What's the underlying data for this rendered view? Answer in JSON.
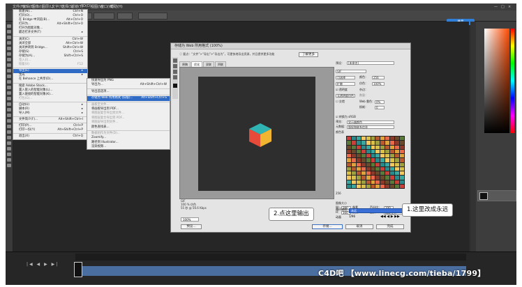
{
  "app": {
    "menubar": [
      "文件(F)",
      "编辑(E)",
      "图像(I)",
      "图层(L)",
      "文字(Y)",
      "选择(S)",
      "滤镜(T)",
      "3D(D)",
      "视图(V)",
      "窗口(W)",
      "帮助(H)"
    ],
    "share_label": "共享",
    "window_controls": [
      "—",
      "□",
      "×"
    ]
  },
  "file_menu": {
    "items": [
      {
        "label": "新建(N)...",
        "shortcut": "Ctrl+N",
        "dim": false
      },
      {
        "label": "打开(O)...",
        "shortcut": "Ctrl+O",
        "dim": false
      },
      {
        "label": "在 Bridge 中浏览(B)...",
        "shortcut": "Alt+Ctrl+O",
        "dim": false
      },
      {
        "label": "打开为...",
        "shortcut": "Alt+Shift+Ctrl+O",
        "dim": false
      },
      {
        "label": "打开为智能对象...",
        "shortcut": "",
        "dim": false
      },
      {
        "label": "最近打开文件(T)",
        "shortcut": "▸",
        "dim": false
      },
      {
        "sep": true
      },
      {
        "label": "关闭(C)",
        "shortcut": "Ctrl+W",
        "dim": false
      },
      {
        "label": "关闭全部",
        "shortcut": "Alt+Ctrl+W",
        "dim": false
      },
      {
        "label": "关闭并转到 Bridge...",
        "shortcut": "Shift+Ctrl+W",
        "dim": false
      },
      {
        "label": "存储(S)",
        "shortcut": "Ctrl+S",
        "dim": false
      },
      {
        "label": "存储为(A)...",
        "shortcut": "Shift+Ctrl+S",
        "dim": false
      },
      {
        "label": "签入(I)...",
        "shortcut": "",
        "dim": true
      },
      {
        "label": "恢复(V)",
        "shortcut": "F12",
        "dim": true
      },
      {
        "sep": true
      },
      {
        "label": "导出(E)",
        "shortcut": "▸",
        "dim": false,
        "active": true
      },
      {
        "label": "生成",
        "shortcut": "▸",
        "dim": false
      },
      {
        "label": "在 Behance 上共享(D)...",
        "shortcut": "",
        "dim": false
      },
      {
        "sep": true
      },
      {
        "label": "搜索 Adobe Stock...",
        "shortcut": "",
        "dim": false
      },
      {
        "label": "置入嵌入的智能对象(L)...",
        "shortcut": "",
        "dim": false
      },
      {
        "label": "置入链接的智能对象(K)...",
        "shortcut": "",
        "dim": false
      },
      {
        "label": "打包(G)...",
        "shortcut": "",
        "dim": true
      },
      {
        "sep": true
      },
      {
        "label": "自动(U)",
        "shortcut": "▸",
        "dim": false
      },
      {
        "label": "脚本(R)",
        "shortcut": "▸",
        "dim": false
      },
      {
        "label": "导入(M)",
        "shortcut": "▸",
        "dim": false
      },
      {
        "sep": true
      },
      {
        "label": "文件简介(F)...",
        "shortcut": "Alt+Shift+Ctrl+I",
        "dim": false
      },
      {
        "sep": true
      },
      {
        "label": "打印(P)...",
        "shortcut": "Ctrl+P",
        "dim": false
      },
      {
        "label": "打印一份(Y)",
        "shortcut": "Alt+Shift+Ctrl+P",
        "dim": false
      },
      {
        "sep": true
      },
      {
        "label": "退出(X)",
        "shortcut": "Ctrl+Q",
        "dim": false
      }
    ]
  },
  "export_submenu": {
    "items": [
      {
        "label": "快速导出为 PNG",
        "shortcut": "",
        "dim": false
      },
      {
        "label": "导出为...",
        "shortcut": "Alt+Shift+Ctrl+W",
        "dim": false
      },
      {
        "sep": true
      },
      {
        "label": "导出首选项...",
        "shortcut": "",
        "dim": false
      },
      {
        "sep": true
      },
      {
        "label": "存储为 Web 所用格式 (旧版)...",
        "shortcut": "Alt+Shift+Ctrl+S",
        "dim": false,
        "active": true
      },
      {
        "sep": true
      },
      {
        "label": "画板至文件...",
        "shortcut": "",
        "dim": true
      },
      {
        "label": "将画板导出到 PDF...",
        "shortcut": "",
        "dim": false
      },
      {
        "label": "将图层复合导出到文件...",
        "shortcut": "",
        "dim": true
      },
      {
        "label": "将图层复合导出到 PDF...",
        "shortcut": "",
        "dim": true
      },
      {
        "label": "将图层导出到文件...",
        "shortcut": "",
        "dim": true
      },
      {
        "label": "颜色查找表...",
        "shortcut": "",
        "dim": false
      },
      {
        "sep": true
      },
      {
        "label": "数据组作为文件(D)...",
        "shortcut": "",
        "dim": true
      },
      {
        "label": "Zoomify...",
        "shortcut": "",
        "dim": false
      },
      {
        "label": "路径到 Illustrator...",
        "shortcut": "",
        "dim": false
      },
      {
        "label": "渲染视频...",
        "shortcut": "",
        "dim": false
      }
    ]
  },
  "dialog": {
    "title": "存储为 Web 所用格式 (100%)",
    "info": "要点：“文件”>“导出”>“导出为”，可更快地导出资源，并且提供更多功能",
    "info_button": "了解更多",
    "tabs": [
      "原稿",
      "优化",
      "双联",
      "四联"
    ],
    "preview_info": [
      "GIF",
      "100 % 仿色",
      "55 秒 @ 56.6 Kbps"
    ],
    "zoom": "100%",
    "preset_label": "预设：",
    "preset_value": "[未命名]",
    "format": "GIF",
    "reduction": "可选择",
    "colors_label": "颜色：",
    "colors_value": "256",
    "dither_algo": "扩散",
    "dither_label": "仿色：",
    "dither_value": "100%",
    "transparency": "透明度",
    "matte_label": "杂边：",
    "transparency_dither": "无透明度仿色",
    "amount_label": "数量：",
    "interlaced": "交错",
    "web_snap_label": "Web 靠色：",
    "web_snap_value": "0%",
    "lossy_label": "损耗：",
    "lossy_value": "0",
    "convert_srgb": "转换为 sRGB",
    "preview_label": "预览：",
    "preview_value": "显示器颜色",
    "metadata_label": "元数据：",
    "metadata_value": "版权和联系信息",
    "color_table_label": "颜色表",
    "color_count": "256",
    "image_size_label": "图像大小",
    "w_label": "W：",
    "w_value": "300",
    "h_label": "H：",
    "h_value": "300",
    "px": "像素",
    "percent_label": "百分比：",
    "percent_value": "100",
    "quality_label": "品质：",
    "quality_value": "两次立方",
    "animation_label": "动画",
    "loop_label": "循环选项：",
    "loop_value": "永远",
    "frame_counter": "1/96",
    "buttons": {
      "preview": "预览...",
      "save": "存储...",
      "cancel": "取消",
      "done": "完成"
    }
  },
  "callouts": {
    "c1": "1.这里改成永远",
    "c2": "2.点这里输出"
  },
  "timeline": {
    "controls": "|◀ ◀ ▶ ▶|"
  },
  "watermark": "C4D吧 【www.linecg.com/tieba/1799】",
  "colors": {
    "accent": "#2f6bc4",
    "selection": "#3a6fd8",
    "timeline_track": "#4b6ea0"
  }
}
